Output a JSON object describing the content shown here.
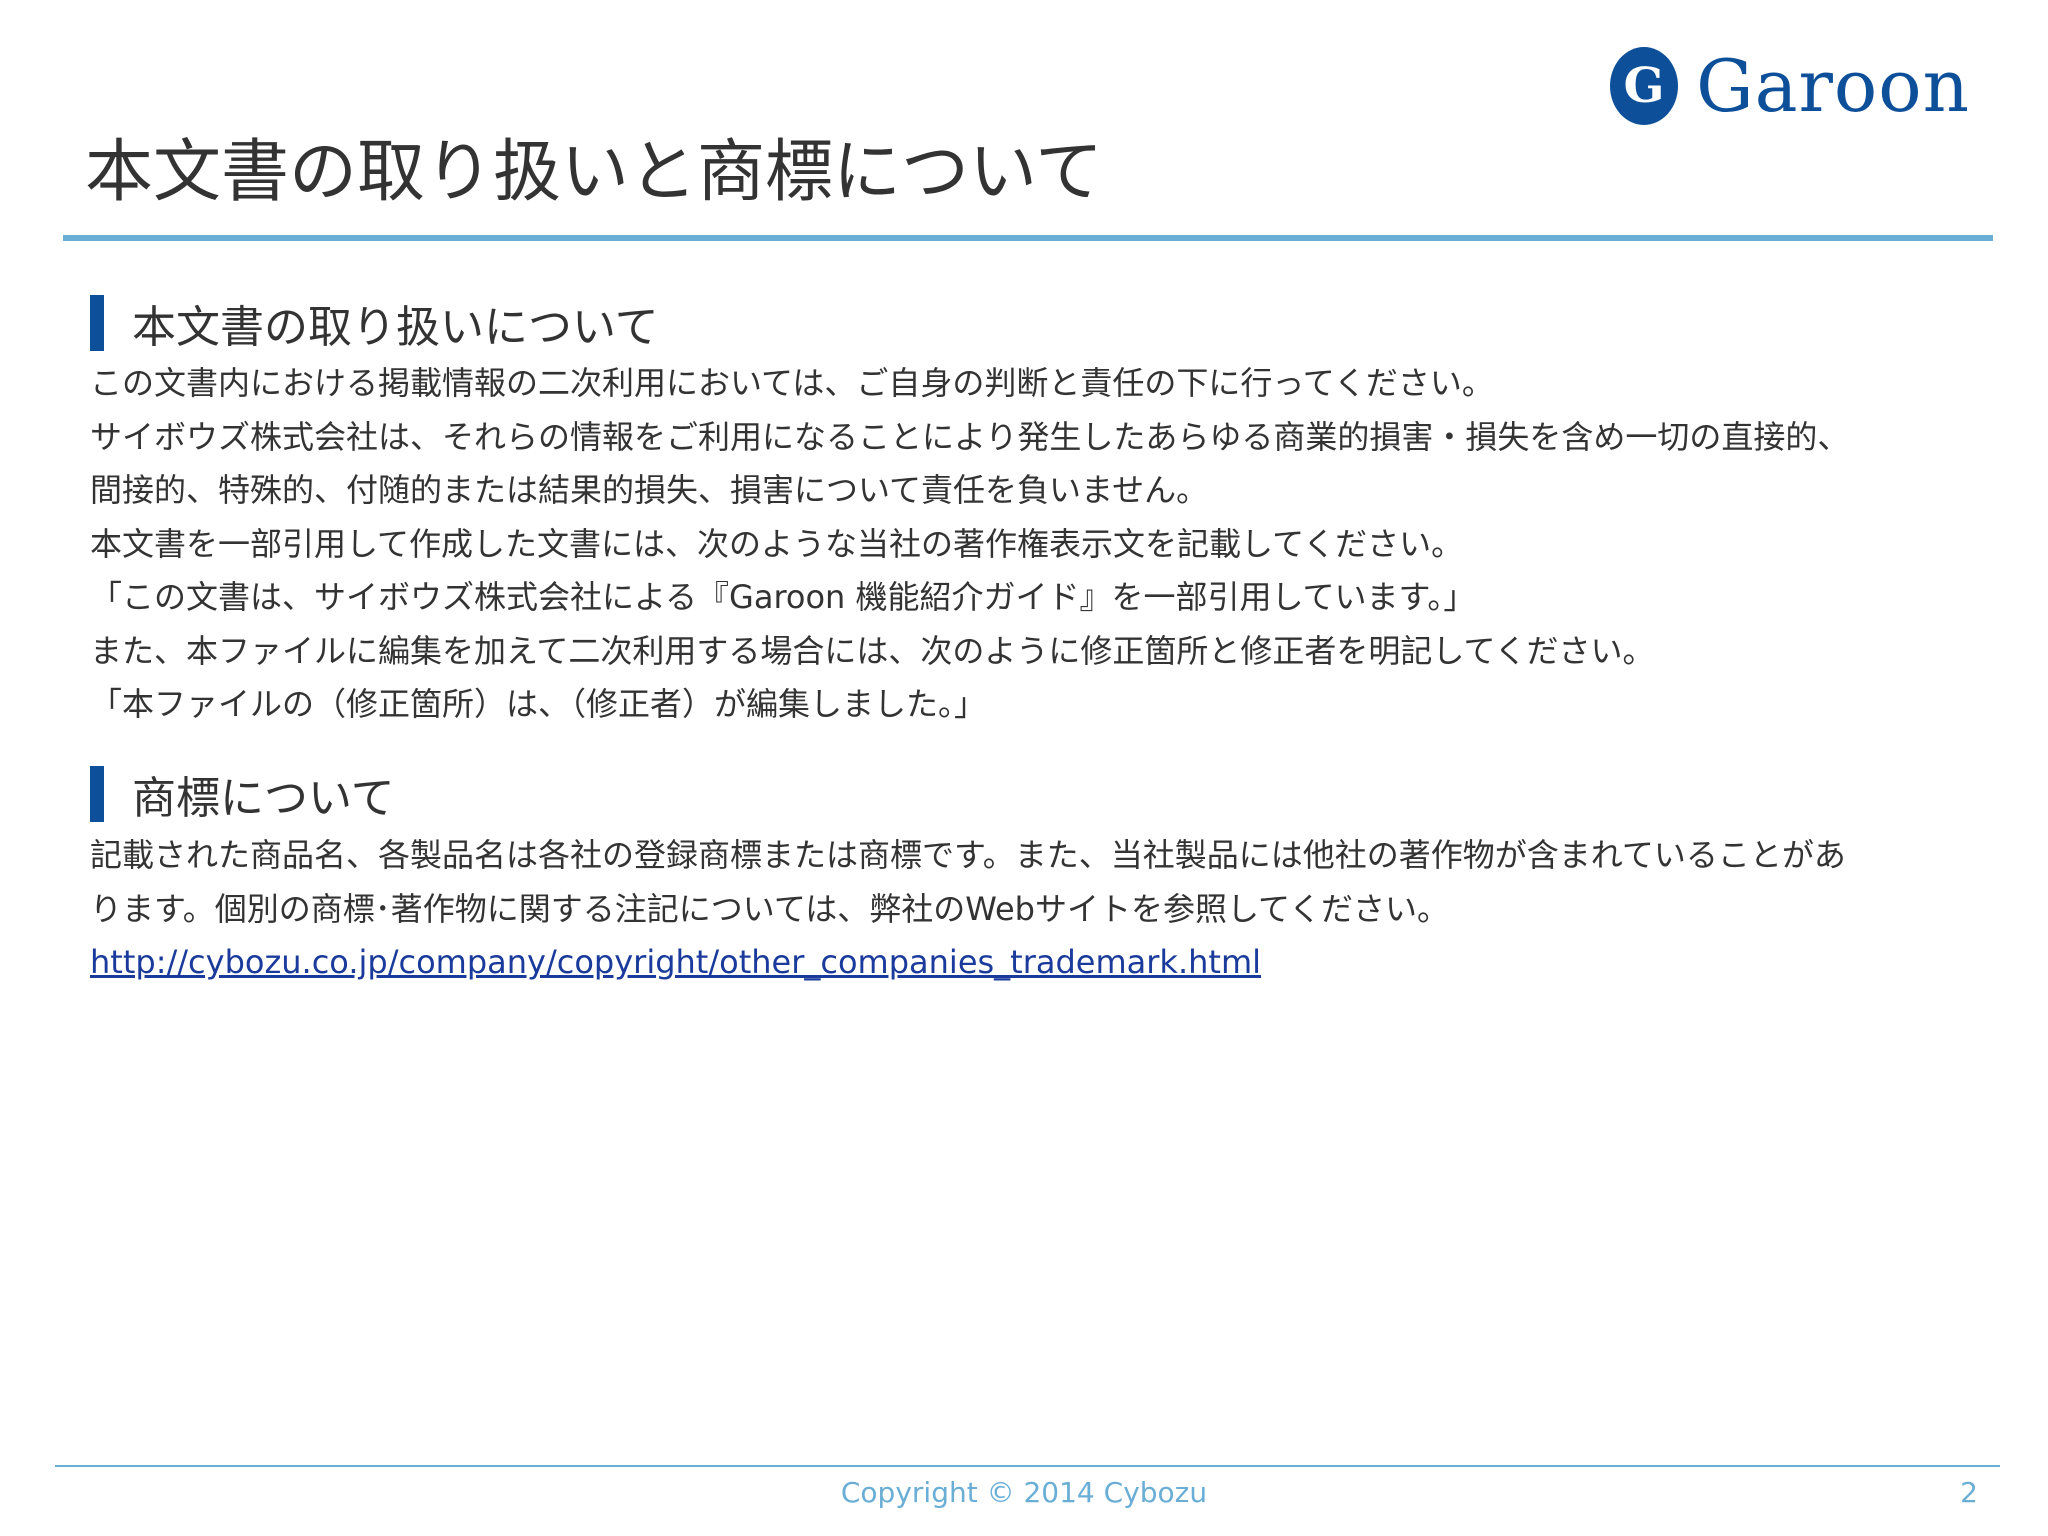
{
  "logo": {
    "mark": "G",
    "text": "Garoon"
  },
  "page_title": "本文書の取り扱いと商標について",
  "sections": [
    {
      "heading": "本文書の取り扱いについて",
      "lines": [
        "この文書内における掲載情報の二次利用においては、ご自身の判断と責任の下に行ってください。",
        "サイボウズ株式会社は、それらの情報をご利用になることにより発生したあらゆる商業的損害・損失を含め一切の直接的、",
        "間接的、特殊的、付随的または結果的損失、損害について責任を負いません。",
        "本文書を一部引用して作成した文書には、次のような当社の著作権表示文を記載してください。",
        "「この文書は、サイボウズ株式会社による『Garoon 機能紹介ガイド』を一部引用しています。」",
        "また、本ファイルに編集を加えて二次利用する場合には、次のように修正箇所と修正者を明記してください。",
        "「本ファイルの（修正箇所）は、（修正者）が編集しました。」"
      ]
    },
    {
      "heading": "商標について",
      "lines": [
        "記載された商品名、各製品名は各社の登録商標または商標です。また、当社製品には他社の著作物が含まれていることがあ",
        "ります。個別の商標･著作物に関する注記については、弊社のWebサイトを参照してください。"
      ],
      "link": "http://cybozu.co.jp/company/copyright/other_companies_trademark.html"
    }
  ],
  "footer": {
    "copyright": "Copyright © 2014 Cybozu",
    "page_number": "2"
  },
  "colors": {
    "brand_blue": "#0e4f9a",
    "rule_blue": "#6aaed6",
    "link_blue": "#1a3b9c"
  }
}
